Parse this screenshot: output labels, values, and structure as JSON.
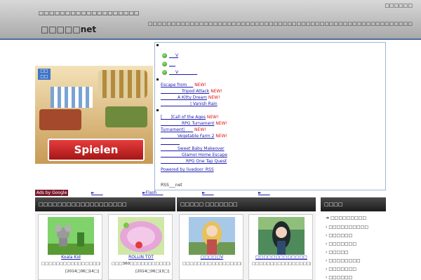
{
  "header": {
    "tagline": "□□□□□□□□□□□□□□□□□□□",
    "title": "□□□□□net",
    "top_link": "□□□□□□",
    "description": "□□□□□□□□□□□□□□□□□□□□□□□□□□□□□□□□□□□□□□□□□□□□□□□□□□□□□□□□□"
  },
  "banner": {
    "logo": "□□\n□□",
    "button_label": "Spielen"
  },
  "rss": {
    "top_items": [
      "___V",
      "___",
      "___V_________"
    ],
    "group1": [
      {
        "text": "Escape from___",
        "new": "NEW!"
      },
      {
        "text": "__________Tripod Attack",
        "new": "NEW!"
      },
      {
        "text": "________A Kitty Dream",
        "new": "NEW!"
      },
      {
        "text": "______________| Vanish Rain",
        "new": ""
      }
    ],
    "group2": [
      {
        "text": "[____]Call of the Ages",
        "new": "NEW!"
      },
      {
        "text": "__________RPG Turnament",
        "new": "NEW!"
      },
      {
        "text": "Turnament|____",
        "new": "NEW!"
      },
      {
        "text": "________Vegetable Farm 2",
        "new": "NEW!"
      },
      {
        "text": "_________",
        "new": ""
      },
      {
        "text": "________Sweet Baby Makeover",
        "new": ""
      },
      {
        "text": "__________Glamor Home Escape",
        "new": ""
      },
      {
        "text": "____________RPG One Tap Quest",
        "new": ""
      }
    ],
    "powered": "Powered by livedoor_RSS",
    "footer": "RSS___net"
  },
  "ads": {
    "label": "Ads by Google",
    "links": [
      "►____",
      "►Flash___",
      "►____",
      "►____"
    ]
  },
  "panels": {
    "left_title": "□□□□□□□□□□□□□□□□□□□",
    "right_title": "□□□□□ □□□□□□□",
    "sidebar_title": "□□□□"
  },
  "cards": [
    {
      "name": "Koala Kid",
      "desc": "□□□□□□□□□□□□□□□□□□□□□□□□□□□□□□",
      "date": "[2014□06□14□]"
    },
    {
      "name": "ROLLIN TOT",
      "desc": "□□□360□□□□□□□□□□□□□□□□□□□□",
      "date": "[2014□06□13□]"
    },
    {
      "name": "□□□□□V",
      "desc": "□□□□□□□□□□□□□□□□□□□□□□□□□□□□□",
      "date": ""
    },
    {
      "name": "□□□□□□□□□□□□□",
      "desc": "□□□□□□□□□□□□□□□□□□□□□□□□□□□□□",
      "date": ""
    }
  ],
  "sidebar": {
    "items": [
      "□□□□□□□□□",
      "□□□□□□□□□□",
      "□□□□□□",
      "□□□□□□□",
      "□□□□□",
      "□□□□□□□□",
      "□□□□□□□",
      "□□□□□□"
    ]
  }
}
